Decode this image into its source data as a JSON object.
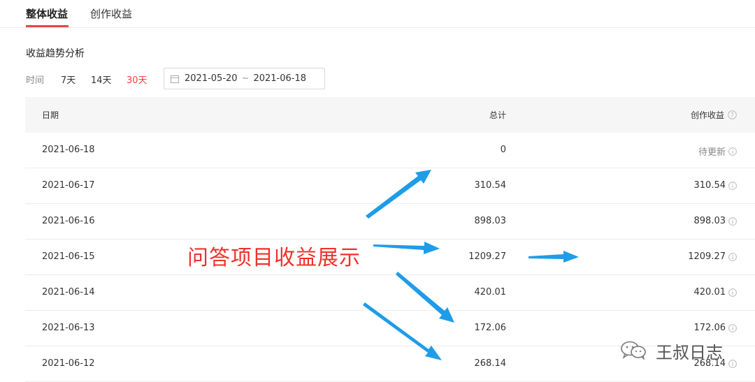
{
  "tabs": [
    {
      "label": "整体收益",
      "active": true
    },
    {
      "label": "创作收益",
      "active": false
    }
  ],
  "section": {
    "title": "收益趋势分析"
  },
  "filter": {
    "label": "时间",
    "ranges": [
      "7天",
      "14天",
      "30天"
    ],
    "active_range": "30天",
    "date_start": "2021-05-20",
    "date_sep": "~",
    "date_end": "2021-06-18"
  },
  "table": {
    "headers": [
      "日期",
      "总计",
      "创作收益"
    ],
    "rows": [
      {
        "date": "2021-06-18",
        "total": "0",
        "creation": "待更新"
      },
      {
        "date": "2021-06-17",
        "total": "310.54",
        "creation": "310.54"
      },
      {
        "date": "2021-06-16",
        "total": "898.03",
        "creation": "898.03"
      },
      {
        "date": "2021-06-15",
        "total": "1209.27",
        "creation": "1209.27"
      },
      {
        "date": "2021-06-14",
        "total": "420.01",
        "creation": "420.01"
      },
      {
        "date": "2021-06-13",
        "total": "172.06",
        "creation": "172.06"
      },
      {
        "date": "2021-06-12",
        "total": "268.14",
        "creation": "268.14"
      }
    ]
  },
  "annotation": {
    "text": "问答项目收益展示"
  },
  "watermark": {
    "text": "王叔日志"
  },
  "colors": {
    "accent": "#f04142",
    "tab_underline": "#e64545",
    "annotation": "#f0302b",
    "arrow": "#1e9ce8"
  }
}
